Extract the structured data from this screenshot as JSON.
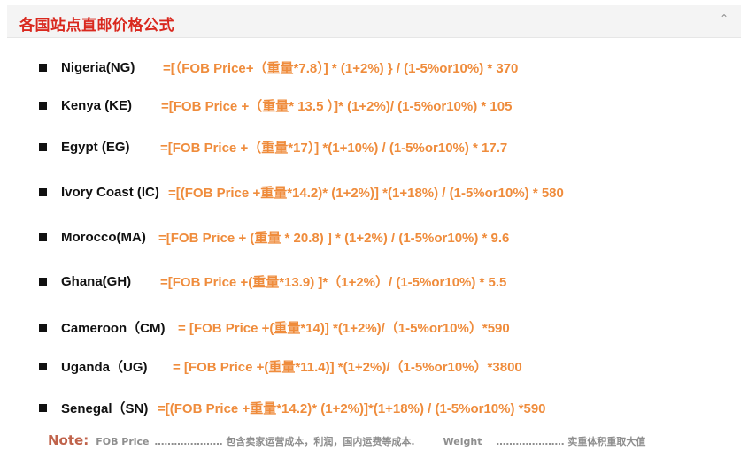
{
  "header": {
    "title": "各国站点直邮价格公式",
    "collapse_glyph": "⌃"
  },
  "colors": {
    "title": "#d9281e",
    "formula": "#ef8c3c",
    "country": "#111111",
    "note_label": "#c0634b",
    "note_text": "#8e8e8e"
  },
  "rows": [
    {
      "country": "Nigeria(NG)",
      "formula": "=[（FOB Price+（重量*7.8）] * (1+2%) } / (1-5%or10%) * 370"
    },
    {
      "country": "Kenya (KE)",
      "formula": "=[FOB Price +（重量* 13.5 ）]* (1+2%)/ (1-5%or10%) * 105"
    },
    {
      "country": "Egypt (EG)",
      "formula": "=[FOB Price +（重量*17）] *(1+10%) / (1-5%or10%) * 17.7"
    },
    {
      "country": "Ivory Coast (IC)",
      "formula": "=[(FOB Price +重量*14.2)* (1+2%)] *(1+18%) / (1-5%or10%) * 580"
    },
    {
      "country": "Morocco(MA)",
      "formula": "=[FOB Price + (重量 * 20.8) ] * (1+2%)  / (1-5%or10%) * 9.6"
    },
    {
      "country": "Ghana(GH)",
      "formula": "=[FOB Price +(重量*13.9) ]*（1+2%）/ (1-5%or10%) * 5.5"
    },
    {
      "country": "Cameroon（CM)",
      "formula": "= [FOB Price +(重量*14)] *(1+2%)/（1-5%or10%）*590"
    },
    {
      "country": "Uganda（UG)",
      "formula": "= [FOB Price +(重量*11.4)] *(1+2%)/（1-5%or10%）*3800"
    },
    {
      "country": "Senegal（SN)",
      "formula": "=[(FOB Price +重量*14.2)* (1+2%)]*(1+18%) / (1-5%or10%) *590"
    }
  ],
  "note": {
    "label": "Note:",
    "fob_term": "FOB Price",
    "fob_desc": "………………… 包含卖家运营成本，利润，国内运费等成本.",
    "weight_term": "Weight",
    "weight_desc": "………………… 实重体积重取大值"
  }
}
